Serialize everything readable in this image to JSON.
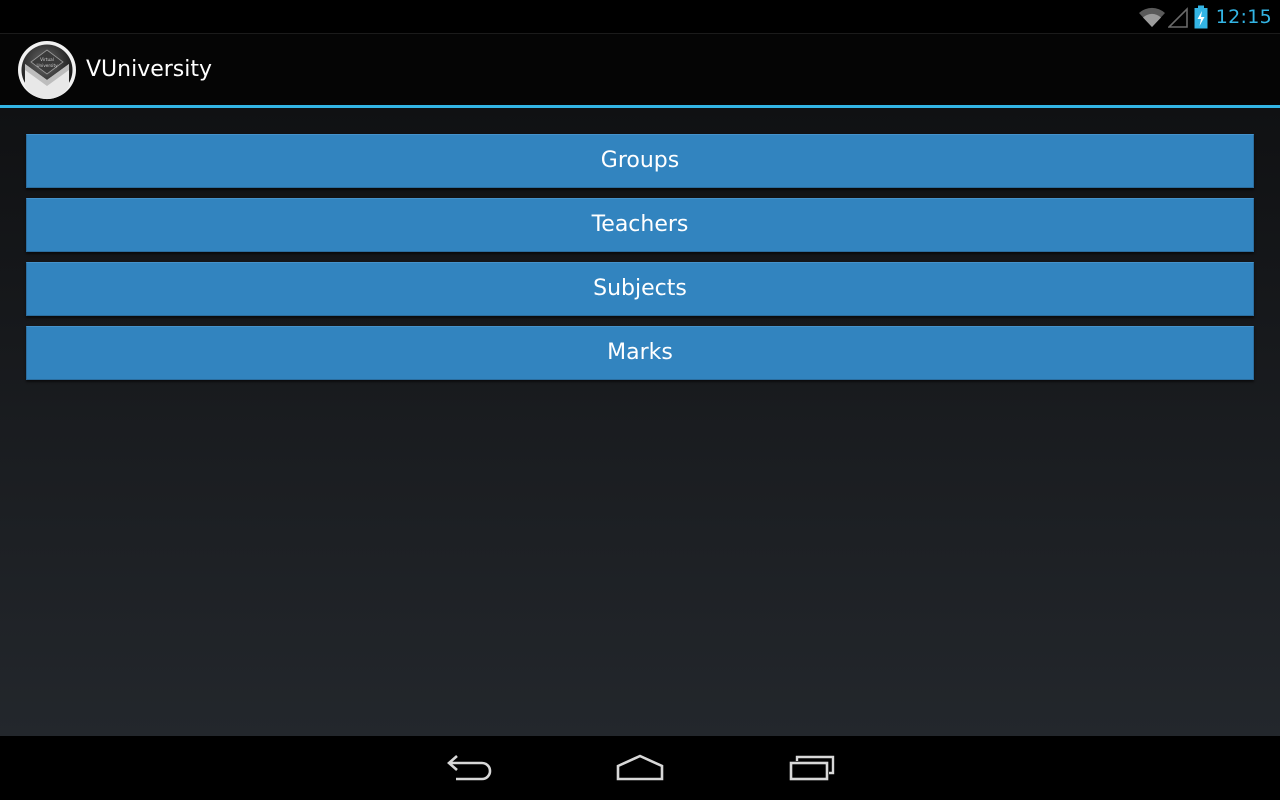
{
  "status_bar": {
    "time": "12:15",
    "icons": [
      "wifi-icon",
      "signal-icon",
      "battery-charging-icon"
    ],
    "accent_color": "#33b5e5"
  },
  "action_bar": {
    "title": "VUniversity",
    "logo_icon": "vuniversity-logo-icon",
    "logo_text": [
      "Virtual",
      "University"
    ]
  },
  "menu": {
    "button_color": "#3284bf",
    "items": [
      {
        "id": "groups",
        "label": "Groups"
      },
      {
        "id": "teachers",
        "label": "Teachers"
      },
      {
        "id": "subjects",
        "label": "Subjects"
      },
      {
        "id": "marks",
        "label": "Marks"
      }
    ]
  },
  "navigation_bar": {
    "buttons": [
      "back-icon",
      "home-icon",
      "recent-apps-icon"
    ]
  }
}
